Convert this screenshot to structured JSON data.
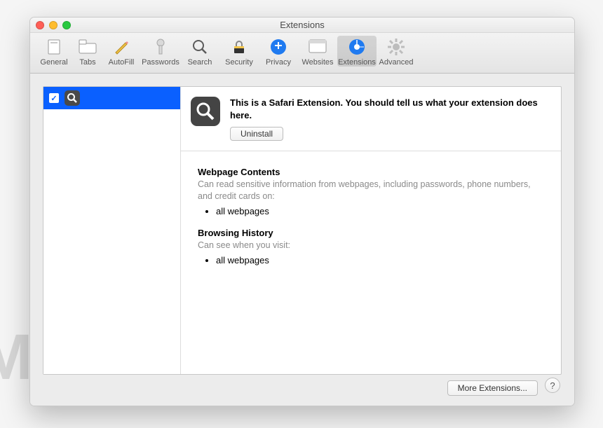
{
  "window": {
    "title": "Extensions"
  },
  "toolbar": {
    "items": [
      {
        "label": "General"
      },
      {
        "label": "Tabs"
      },
      {
        "label": "AutoFill"
      },
      {
        "label": "Passwords"
      },
      {
        "label": "Search"
      },
      {
        "label": "Security"
      },
      {
        "label": "Privacy"
      },
      {
        "label": "Websites"
      },
      {
        "label": "Extensions"
      },
      {
        "label": "Advanced"
      }
    ]
  },
  "sidebar": {
    "selected": {
      "name": ""
    }
  },
  "detail": {
    "description": "This is a Safari Extension. You should tell us what your extension does here.",
    "uninstall_label": "Uninstall",
    "perm1_title": "Webpage Contents",
    "perm1_text": "Can read sensitive information from webpages, including passwords, phone numbers, and credit cards on:",
    "perm1_item": "all webpages",
    "perm2_title": "Browsing History",
    "perm2_text": "Can see when you visit:",
    "perm2_item": "all webpages"
  },
  "footer": {
    "more_label": "More Extensions...",
    "help_label": "?"
  },
  "watermark": "MALWARETIPS"
}
